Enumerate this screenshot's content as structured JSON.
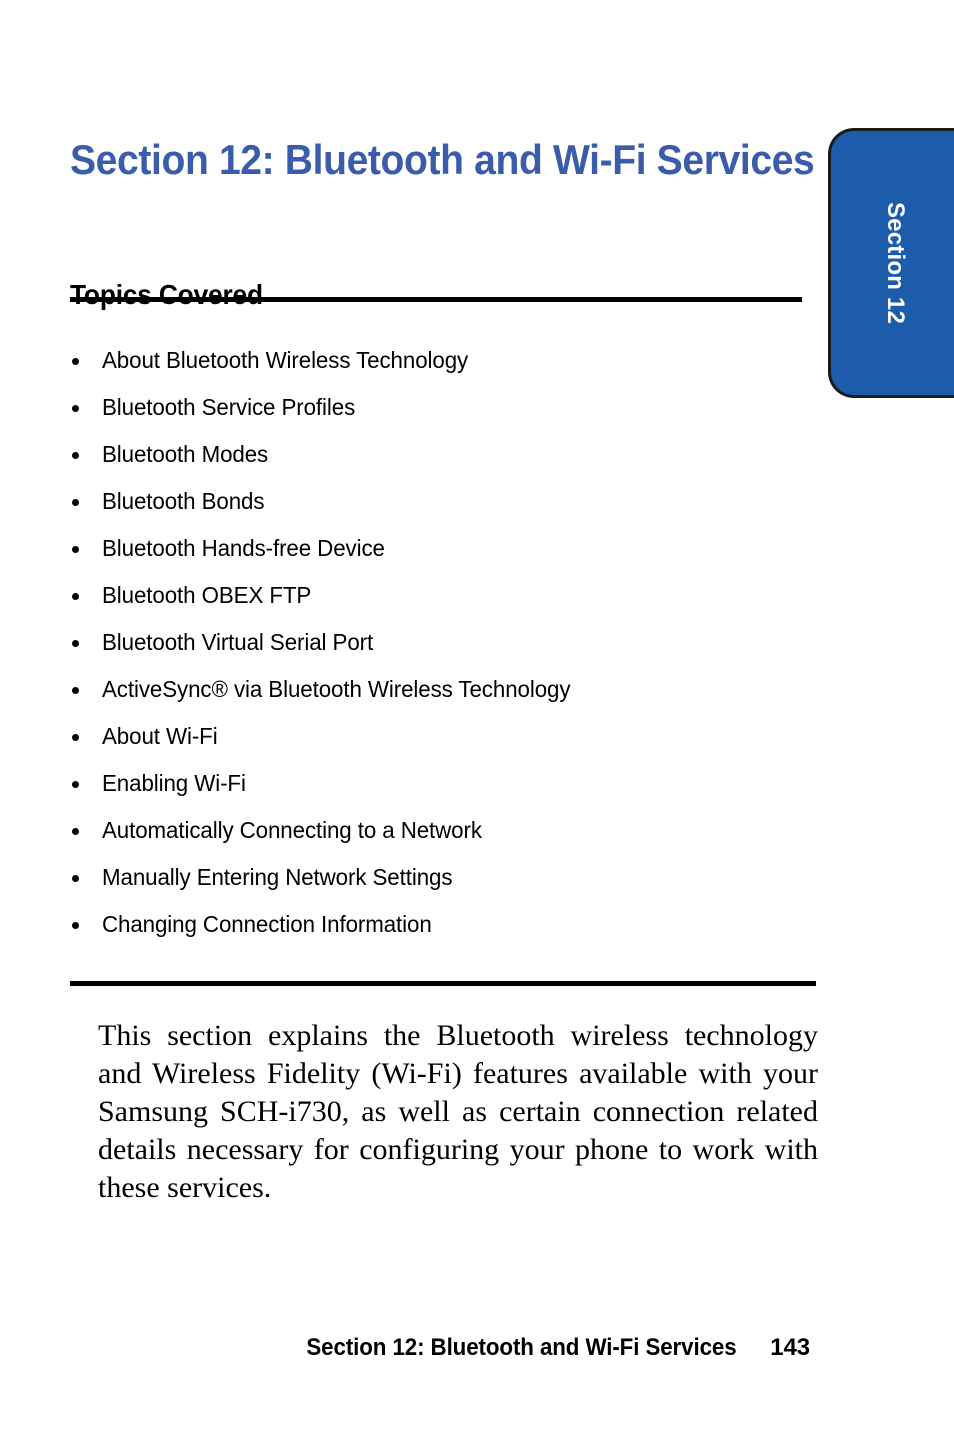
{
  "page": {
    "title": "Section 12: Bluetooth and Wi-Fi Services",
    "side_tab_label": "Section 12",
    "accent_blue": "#1d5cab",
    "title_blue": "#3a5cab"
  },
  "topics": {
    "heading": "Topics Covered",
    "items": [
      "About Bluetooth Wireless Technology",
      "Bluetooth Service Profiles",
      "Bluetooth Modes",
      "Bluetooth Bonds",
      "Bluetooth Hands-free Device",
      "Bluetooth OBEX FTP",
      "Bluetooth Virtual Serial Port",
      "ActiveSync® via Bluetooth Wireless Technology",
      "About Wi-Fi",
      "Enabling Wi-Fi",
      "Automatically Connecting to a Network",
      "Manually Entering Network Settings",
      "Changing Connection Information"
    ]
  },
  "intro": {
    "paragraph": "This section explains the Bluetooth wireless technology and Wireless Fidelity (Wi-Fi) features available with your Samsung SCH-i730, as well as certain connection related details necessary for configuring your phone to work with these services."
  },
  "footer": {
    "title": "Section 12: Bluetooth and Wi-Fi Services",
    "page_number": "143"
  }
}
